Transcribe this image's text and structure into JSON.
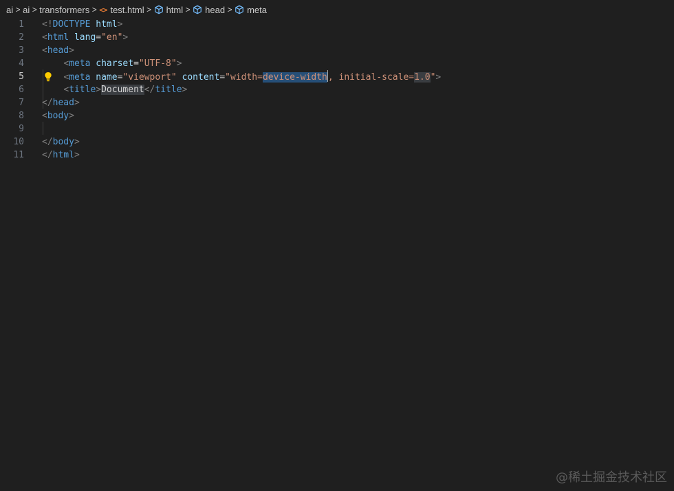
{
  "breadcrumb": {
    "items": [
      "ai",
      "ai",
      "transformers",
      "test.html",
      "html",
      "head",
      "meta"
    ],
    "file_icon": "<>",
    "separator": ">"
  },
  "editor": {
    "line_numbers": [
      "1",
      "2",
      "3",
      "4",
      "5",
      "6",
      "7",
      "8",
      "9",
      "10",
      "11"
    ],
    "active_line": "5",
    "colors": {
      "tag": "#569cd6",
      "attribute": "#9cdcfe",
      "string": "#ce9178",
      "punctuation": "#808080",
      "selection": "#264f78",
      "background": "#1f1f1f"
    },
    "lines": {
      "l1": {
        "p1": "<!",
        "doctype": "DOCTYPE",
        "html": "html",
        "p2": ">"
      },
      "l2": {
        "p1": "<",
        "tag": "html",
        "attr": "lang",
        "eq": "=",
        "val": "\"en\"",
        "p2": ">"
      },
      "l3": {
        "p1": "<",
        "tag": "head",
        "p2": ">"
      },
      "l4": {
        "p1": "<",
        "tag": "meta",
        "attr": "charset",
        "eq": "=",
        "val": "\"UTF-8\"",
        "p2": ">"
      },
      "l5": {
        "p1": "<",
        "tag": "meta",
        "attr1": "name",
        "eq1": "=",
        "val1": "\"viewport\"",
        "attr2": "content",
        "eq2": "=",
        "val2_a": "\"width=",
        "val2_sel": "device-width",
        "val2_b": ", initial-scale=",
        "val2_hl": "1.0",
        "val2_c": "\"",
        "p2": ">"
      },
      "l6": {
        "p1": "<",
        "tag": "title",
        "p2": ">",
        "text": "Document",
        "p3": "</",
        "tag2": "title",
        "p4": ">"
      },
      "l7": {
        "p1": "</",
        "tag": "head",
        "p2": ">"
      },
      "l8": {
        "p1": "<",
        "tag": "body",
        "p2": ">"
      },
      "l10": {
        "p1": "</",
        "tag": "body",
        "p2": ">"
      },
      "l11": {
        "p1": "</",
        "tag": "html",
        "p2": ">"
      }
    }
  },
  "watermark": "@稀土掘金技术社区"
}
